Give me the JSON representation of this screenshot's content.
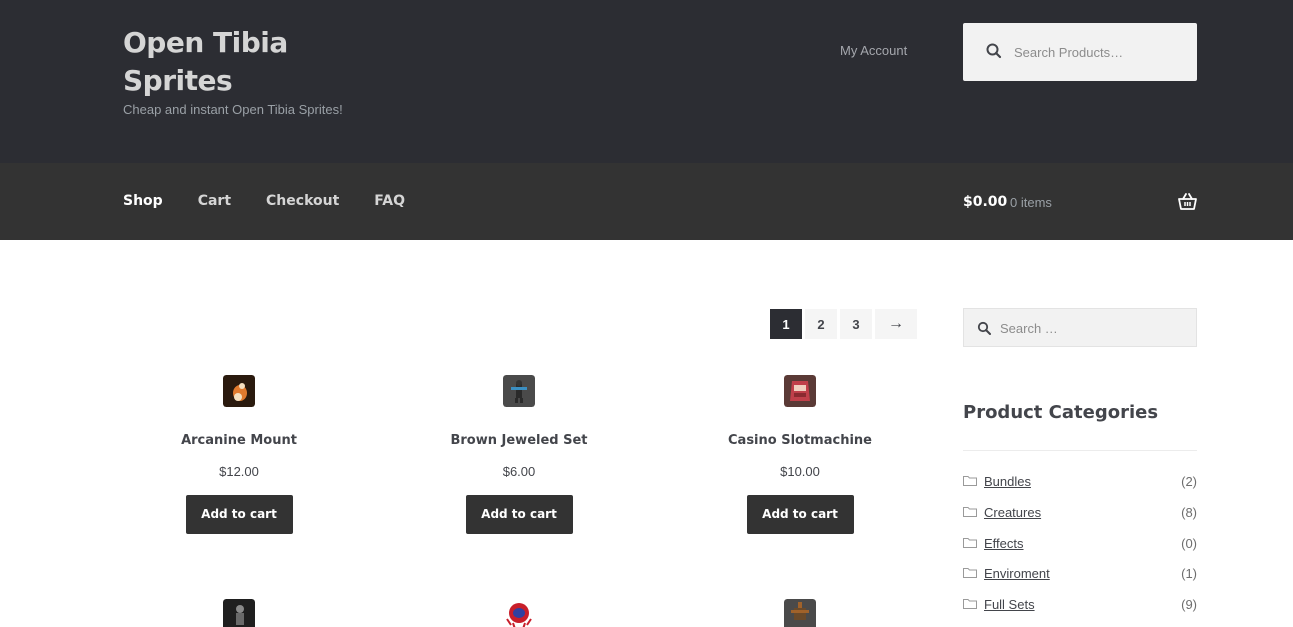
{
  "site": {
    "title_line1": "Open Tibia",
    "title_line2": "Sprites",
    "tagline": "Cheap and instant Open Tibia Sprites!"
  },
  "header": {
    "my_account": "My Account",
    "search_placeholder": "Search Products…"
  },
  "nav": {
    "items": [
      "Shop",
      "Cart",
      "Checkout",
      "FAQ"
    ],
    "cart_total": "$0.00",
    "cart_count": "0 items"
  },
  "pagination": {
    "pages": [
      "1",
      "2",
      "3"
    ],
    "current": "1",
    "next": "→"
  },
  "products": [
    {
      "title": "Arcanine Mount",
      "price": "$12.00",
      "button": "Add to cart",
      "thumb_color": "#2a1a0e",
      "accent": "#e07a2e"
    },
    {
      "title": "Brown Jeweled Set",
      "price": "$6.00",
      "button": "Add to cart",
      "thumb_color": "#4a4a4a",
      "accent": "#3b8fc2"
    },
    {
      "title": "Casino Slotmachine",
      "price": "$10.00",
      "button": "Add to cart",
      "thumb_color": "#5a3a36",
      "accent": "#c0404a"
    }
  ],
  "products_row2": [
    {
      "thumb_color": "#1f1f1f",
      "accent": "#8a8a8a"
    },
    {
      "thumb_color": "#ffffff",
      "accent": "#c81e2a"
    },
    {
      "thumb_color": "#4a4a4a",
      "accent": "#a0622a"
    }
  ],
  "sidebar": {
    "search_placeholder": "Search …",
    "categories_heading": "Product Categories",
    "categories": [
      {
        "name": "Bundles",
        "count": "(2)"
      },
      {
        "name": "Creatures",
        "count": "(8)"
      },
      {
        "name": "Effects",
        "count": "(0)"
      },
      {
        "name": "Enviroment",
        "count": "(1)"
      },
      {
        "name": "Full Sets",
        "count": "(9)"
      }
    ]
  },
  "icons": {
    "search": "search-icon",
    "basket": "basket-icon",
    "folder": "folder-icon"
  },
  "colors": {
    "header_bg": "#2c2d33",
    "nav_bg": "#333333",
    "button_bg": "#333333"
  }
}
